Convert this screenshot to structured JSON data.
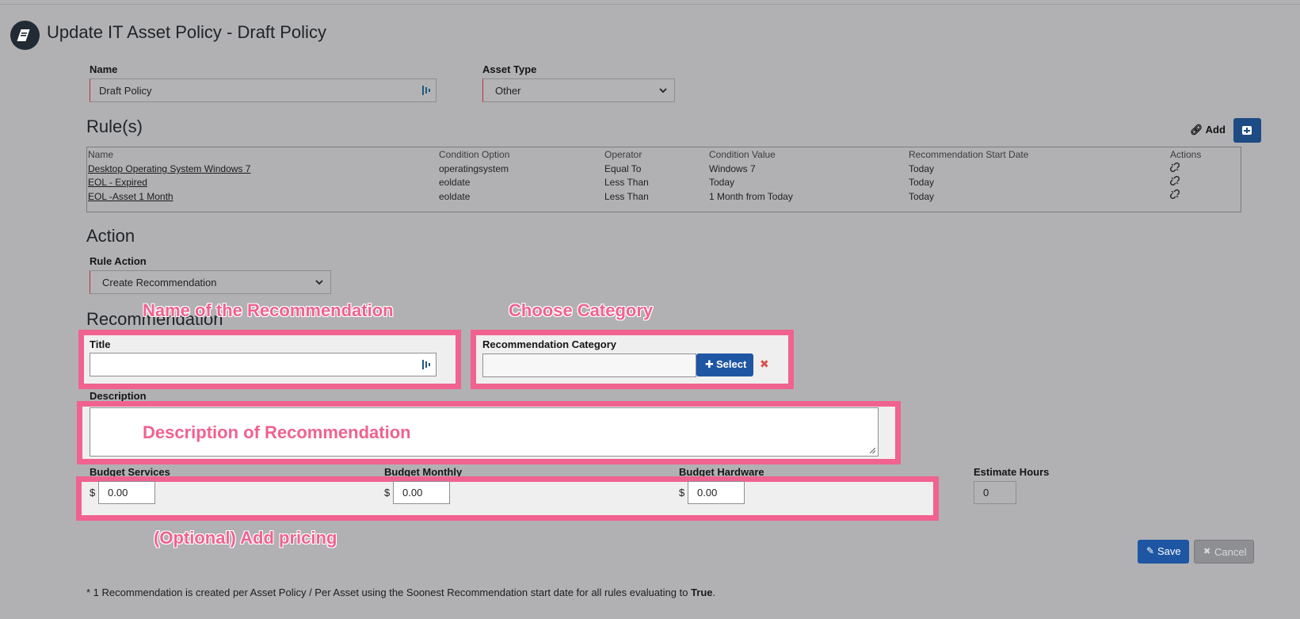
{
  "page": {
    "title": "Update IT Asset Policy - Draft Policy"
  },
  "form": {
    "name_label": "Name",
    "name_value": "Draft Policy",
    "asset_type_label": "Asset Type",
    "asset_type_value": "Other"
  },
  "rules": {
    "heading": "Rule(s)",
    "add_label": "Add",
    "columns": [
      "Name",
      "Condition Option",
      "Operator",
      "Condition Value",
      "Recommendation Start Date",
      "Actions"
    ],
    "rows": [
      [
        "Desktop Operating System Windows 7",
        "operatingsystem",
        "Equal To",
        "Windows 7",
        "Today"
      ],
      [
        "EOL - Expired",
        "eoldate",
        "Less Than",
        "Today",
        "Today"
      ],
      [
        "EOL -Asset 1 Month",
        "eoldate",
        "Less Than",
        "1 Month from Today",
        "Today"
      ]
    ]
  },
  "action": {
    "heading": "Action",
    "rule_action_label": "Rule Action",
    "rule_action_value": "Create Recommendation"
  },
  "recommendation": {
    "heading": "Recommendation",
    "title_label": "Title",
    "title_value": "",
    "category_label": "Recommendation Category",
    "category_value": "",
    "select_button": "Select",
    "description_label": "Description",
    "description_value": ""
  },
  "budget": {
    "services_label": "Budget Services",
    "services_value": "0.00",
    "monthly_label": "Budget Monthly",
    "monthly_value": "0.00",
    "hardware_label": "Budget Hardware",
    "hardware_value": "0.00",
    "currency": "$",
    "estimate_hours_label": "Estimate Hours",
    "estimate_hours_value": "0"
  },
  "buttons": {
    "save": "Save",
    "cancel": "Cancel"
  },
  "footnote": {
    "text": "* 1 Recommendation is created per Asset Policy / Per Asset using the Soonest Recommendation start date for all rules evaluating to ",
    "bold": "True",
    "end": "."
  },
  "annotations": {
    "name_of_recommendation": "Name of the Recommendation",
    "choose_category": "Choose Category",
    "description_of_recommendation": "Description of Recommendation",
    "optional_pricing": "(Optional) Add pricing"
  },
  "colors": {
    "background": "#b1b1b3",
    "highlight": "#f0628f",
    "primary_button": "#1e56a3",
    "required_border": "#b8363a"
  }
}
